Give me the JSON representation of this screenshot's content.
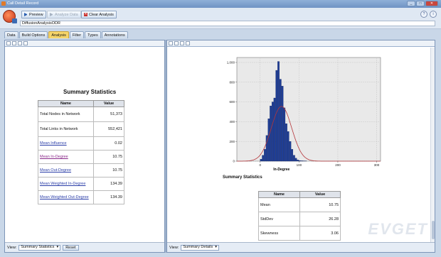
{
  "window": {
    "title": "Call Detail Record"
  },
  "toolbar": {
    "preview_label": "Preview",
    "analyze_label": "Analyze Data",
    "clear_label": "Clear Analysis",
    "node_name": "DiffusionAnalysisODR"
  },
  "tabs": [
    {
      "label": "Data",
      "active": false
    },
    {
      "label": "Build Options",
      "active": false
    },
    {
      "label": "Analysis",
      "active": true
    },
    {
      "label": "Filter",
      "active": false
    },
    {
      "label": "Types",
      "active": false
    },
    {
      "label": "Annotations",
      "active": false
    }
  ],
  "left": {
    "title": "Summary Statistics",
    "table": {
      "headers": [
        "Name",
        "Value"
      ],
      "rows": [
        {
          "name": "Total Nodes in Network",
          "value": "51,373",
          "link": false
        },
        {
          "name": "Total Links in Network",
          "value": "552,421",
          "link": false
        },
        {
          "name": "Mean Influence",
          "value": "0.02",
          "link": true
        },
        {
          "name": "Mean In-Degree",
          "value": "10.75",
          "link": true
        },
        {
          "name": "Mean Out-Degree",
          "value": "10.75",
          "link": true
        },
        {
          "name": "Mean Weighted In-Degree",
          "value": "134.39",
          "link": true
        },
        {
          "name": "Mean Weighted Out-Degree",
          "value": "134.39",
          "link": true
        }
      ]
    },
    "footer": {
      "view_label": "View:",
      "view_value": "Summary Statistics",
      "reset_label": "Reset"
    }
  },
  "right": {
    "title": "Summary Statistics",
    "table": {
      "headers": [
        "Name",
        "Value"
      ],
      "rows": [
        {
          "name": "Mean",
          "value": "10.75"
        },
        {
          "name": "StdDev",
          "value": "26.28"
        },
        {
          "name": "Skewness",
          "value": "3.06"
        }
      ]
    },
    "footer": {
      "view_label": "View:",
      "view_value": "Summary Details"
    }
  },
  "chart_data": {
    "type": "bar",
    "xlabel": "In-Degree",
    "ylabel": "",
    "xlim": [
      -60,
      310
    ],
    "ylim": [
      0,
      1050
    ],
    "x_ticks": [
      0,
      100,
      200,
      300
    ],
    "y_ticks": [
      0,
      200,
      400,
      600,
      800,
      1000
    ],
    "y_tick_labels": [
      "0",
      "200",
      "400",
      "600",
      "800",
      "1,000"
    ],
    "bin_width": 5,
    "bins_start": 0,
    "counts": [
      20,
      60,
      120,
      260,
      430,
      560,
      600,
      640,
      920,
      1010,
      830,
      760,
      540,
      380,
      300,
      200,
      120,
      60,
      30,
      12,
      6,
      4,
      3,
      2
    ],
    "normal_curve": {
      "mean": 55,
      "stddev": 26.28,
      "peak": 555
    },
    "grid": true,
    "colors": {
      "bars": "#1f3e96",
      "curve": "#b5363a",
      "plot_bg": "#e9e9e9"
    }
  },
  "watermark": "EVGET"
}
